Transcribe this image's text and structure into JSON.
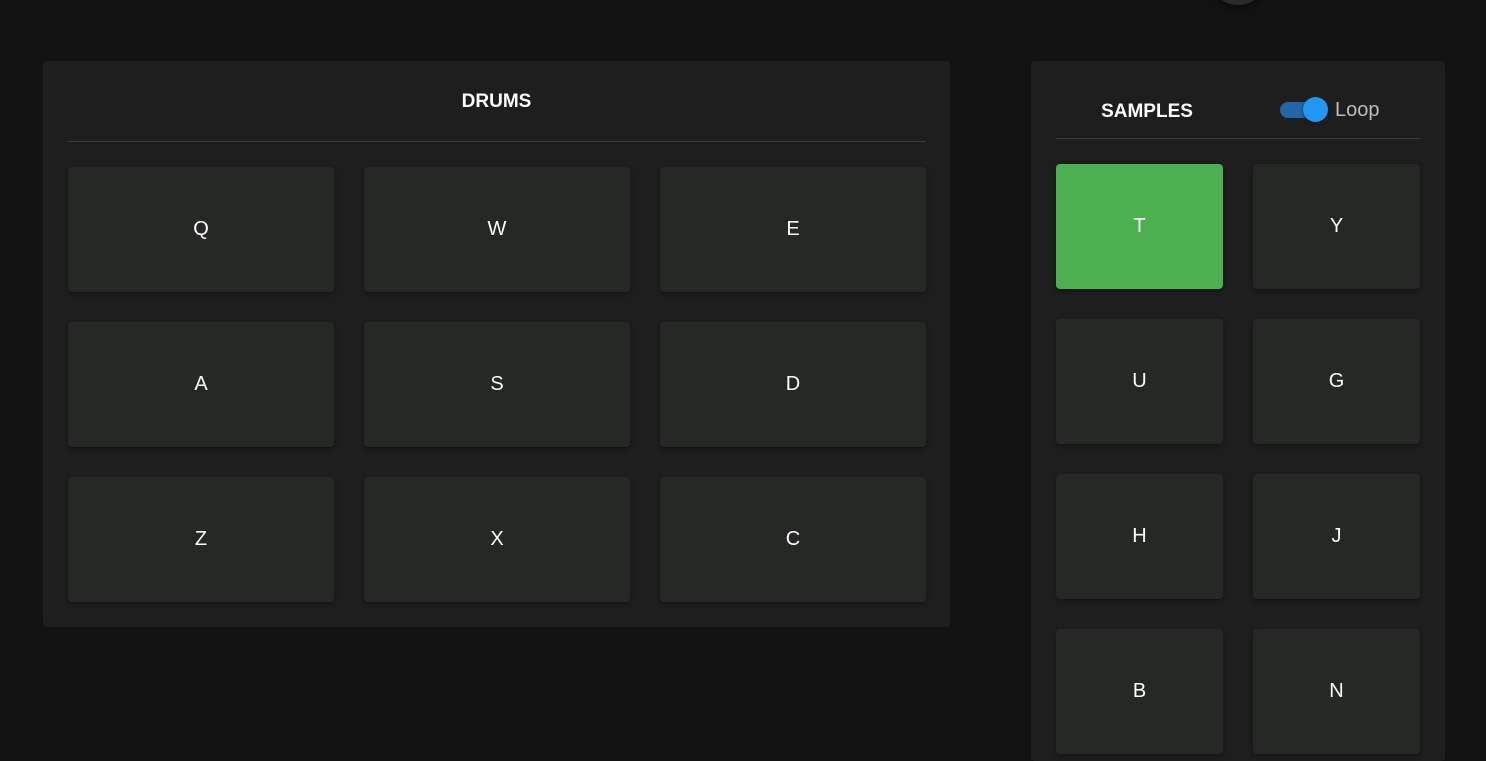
{
  "drums": {
    "title": "DRUMS",
    "pads": [
      "Q",
      "W",
      "E",
      "A",
      "S",
      "D",
      "Z",
      "X",
      "C"
    ]
  },
  "samples": {
    "title": "SAMPLES",
    "loop_label": "Loop",
    "loop_enabled": true,
    "active_pad": "T",
    "pads": [
      "T",
      "Y",
      "U",
      "G",
      "H",
      "J",
      "B",
      "N"
    ]
  },
  "colors": {
    "active": "#4caf50",
    "toggle": "#2196f3",
    "background": "#121212",
    "panel": "#1e1e1e",
    "pad": "#262826"
  }
}
